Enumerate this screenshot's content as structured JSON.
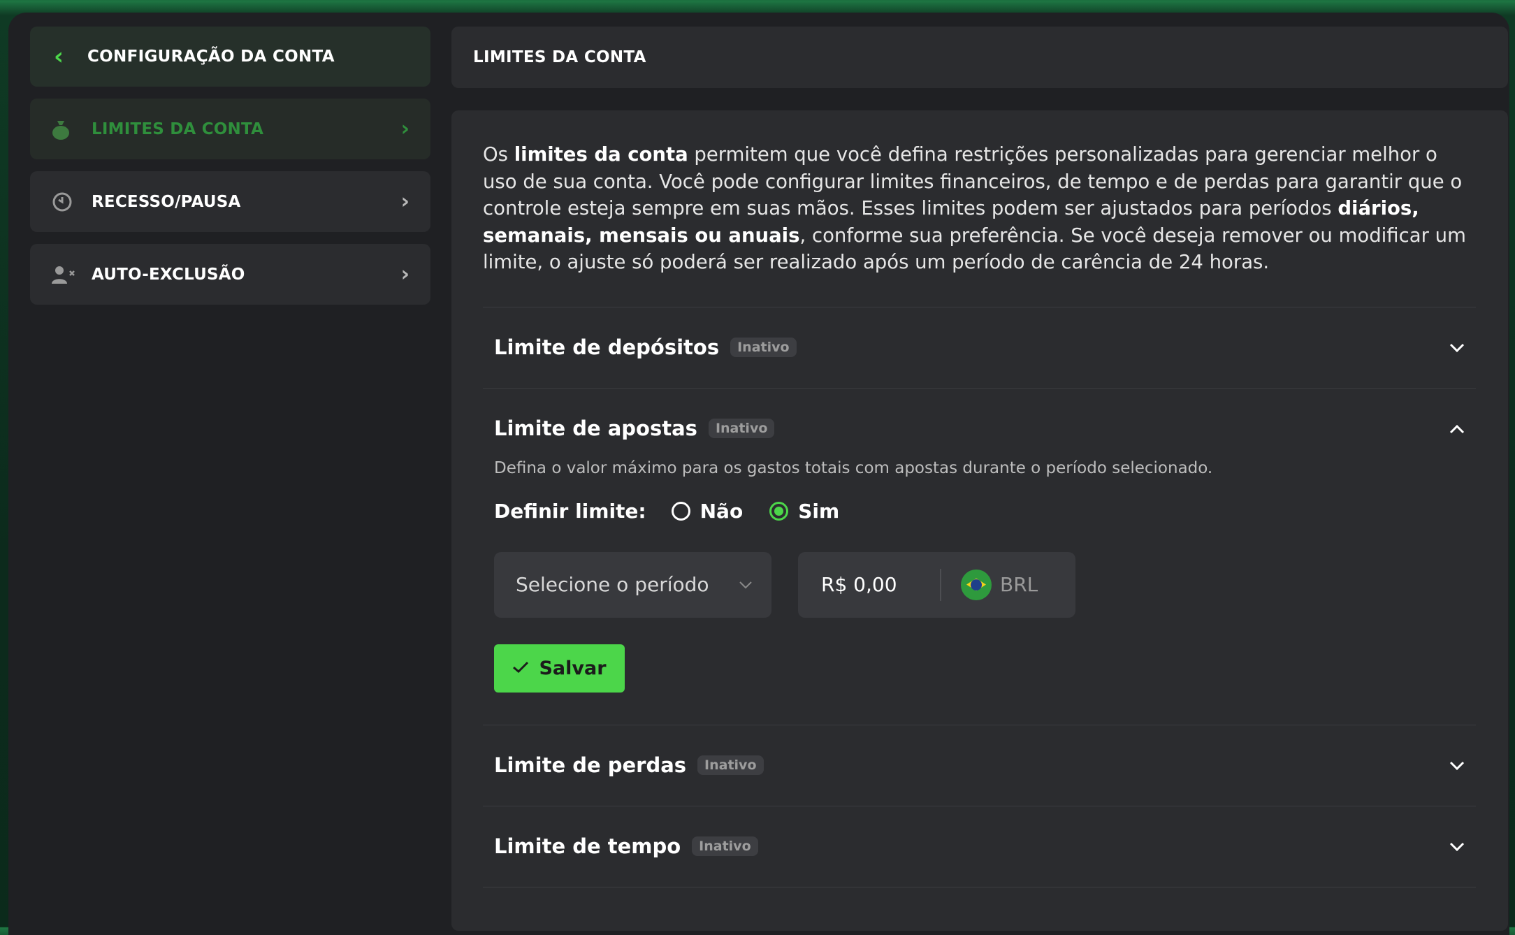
{
  "sidebar": {
    "header_title": "CONFIGURAÇÃO DA CONTA",
    "items": [
      {
        "label": "LIMITES DA CONTA",
        "icon": "money-bag-icon",
        "active": true
      },
      {
        "label": "RECESSO/PAUSA",
        "icon": "timer-icon",
        "active": false
      },
      {
        "label": "AUTO-EXCLUSÃO",
        "icon": "user-remove-icon",
        "active": false
      }
    ]
  },
  "main": {
    "header_title": "LIMITES DA CONTA",
    "intro": {
      "p1": "Os ",
      "b1": "limites da conta",
      "p2": " permitem que você defina restrições personalizadas para gerenciar melhor o uso de sua conta. Você pode configurar limites financeiros, de tempo e de perdas para garantir que o controle esteja sempre em suas mãos. Esses limites podem ser ajustados para períodos ",
      "b2": "diários, semanais, mensais ou anuais",
      "p3": ", conforme sua preferência. Se você deseja remover ou modificar um limite, o ajuste só poderá ser realizado após um período de carência de 24 horas."
    },
    "sections": [
      {
        "title": "Limite de depósitos",
        "badge": "Inativo",
        "expanded": false
      },
      {
        "title": "Limite de apostas",
        "badge": "Inativo",
        "expanded": true
      },
      {
        "title": "Limite de perdas",
        "badge": "Inativo",
        "expanded": false
      },
      {
        "title": "Limite de tempo",
        "badge": "Inativo",
        "expanded": false
      }
    ],
    "bets_form": {
      "description": "Defina o valor máximo para os gastos totais com apostas durante o período selecionado.",
      "define_label": "Definir limite:",
      "option_no": "Não",
      "option_yes": "Sim",
      "selected_option": "Sim",
      "period_placeholder": "Selecione o período",
      "amount_value": "R$ 0,00",
      "currency": "BRL",
      "save_label": "Salvar"
    }
  },
  "colors": {
    "accent": "#4cd64a",
    "background": "#1f2023",
    "card": "#2b2c2f"
  }
}
